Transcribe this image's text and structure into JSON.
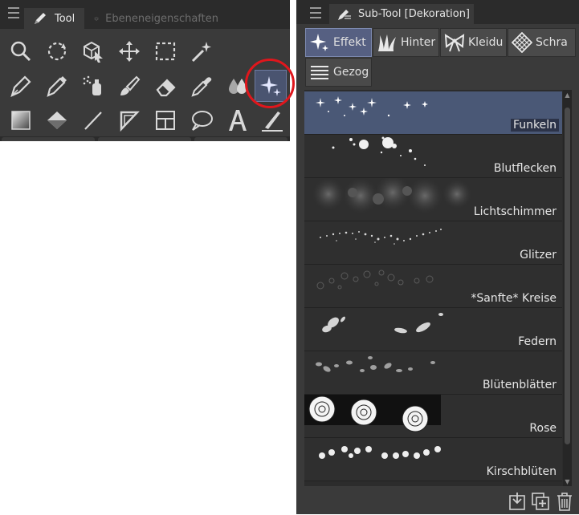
{
  "tool_panel": {
    "tabs": [
      {
        "label": "Tool",
        "icon": "pen-icon"
      },
      {
        "label": "Ebeneneigenschaften",
        "icon": "layer-property-icon"
      }
    ],
    "rows": [
      [
        "zoom-icon",
        "rotate-icon",
        "object-select-icon",
        "move-icon",
        "selection-rect-icon",
        "auto-select-wand-icon"
      ],
      [
        "pen-icon",
        "pencil-icon",
        "airbrush-icon",
        "brush-icon",
        "eraser-icon",
        "eyedropper-icon",
        "blend-icon",
        "decoration-sparkle-icon"
      ],
      [
        "gradient-icon",
        "fill-bucket-icon",
        "line-icon",
        "ruler-icon",
        "frame-border-icon",
        "speech-balloon-icon",
        "text-icon",
        "correct-line-icon"
      ]
    ],
    "selected_tool": "decoration-sparkle-icon",
    "highlight_color": "#e0161c"
  },
  "subtool_panel": {
    "title": "Sub-Tool [Dekoration]",
    "groups": [
      {
        "label": "Effekt",
        "icon": "sparkle-group-icon",
        "active": true
      },
      {
        "label": "Hinter",
        "icon": "grass-group-icon",
        "active": false
      },
      {
        "label": "Kleidu",
        "icon": "ribbon-group-icon",
        "active": false
      },
      {
        "label": "Schra",
        "icon": "hatch-group-icon",
        "active": false
      },
      {
        "label": "Gezog",
        "icon": "lines-group-icon",
        "active": false
      }
    ],
    "items": [
      {
        "label": "Funkeln",
        "preview": "sparkles",
        "selected": true
      },
      {
        "label": "Blutflecken",
        "preview": "splatter",
        "selected": false
      },
      {
        "label": "Lichtschimmer",
        "preview": "bokeh",
        "selected": false
      },
      {
        "label": "Glitzer",
        "preview": "glitter",
        "selected": false
      },
      {
        "label": "*Sanfte* Kreise",
        "preview": "circles",
        "selected": false
      },
      {
        "label": "Federn",
        "preview": "feathers",
        "selected": false
      },
      {
        "label": "Blütenblätter",
        "preview": "petals",
        "selected": false
      },
      {
        "label": "Rose",
        "preview": "roses",
        "selected": false
      },
      {
        "label": "Kirschblüten",
        "preview": "cherry",
        "selected": false
      }
    ],
    "footer_icons": [
      "import-subtool-icon",
      "duplicate-subtool-icon",
      "delete-subtool-icon"
    ],
    "accent_color": "#566082"
  }
}
